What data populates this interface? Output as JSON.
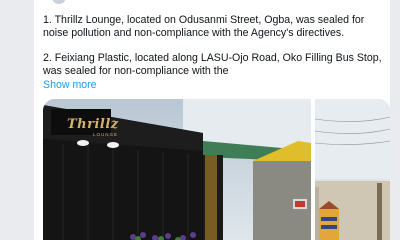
{
  "post": {
    "paragraphs": [
      "1. Thrillz Lounge, located on Odusanmi Street, Ogba, was sealed for noise pollution and non-compliance with the Agency's directives.",
      "2. Feixiang Plastic, located along LASU-Ojo Road, Oko Filling Bus Stop, was sealed for non-compliance with the"
    ],
    "show_more_label": "Show more"
  },
  "media": {
    "main_photo_sign": "Thrillz",
    "main_photo_sign_sub": "LOUNGE"
  },
  "colors": {
    "link": "#1d9bf0",
    "text": "#0f1419",
    "background": "#e9ebee",
    "card": "#ffffff"
  }
}
